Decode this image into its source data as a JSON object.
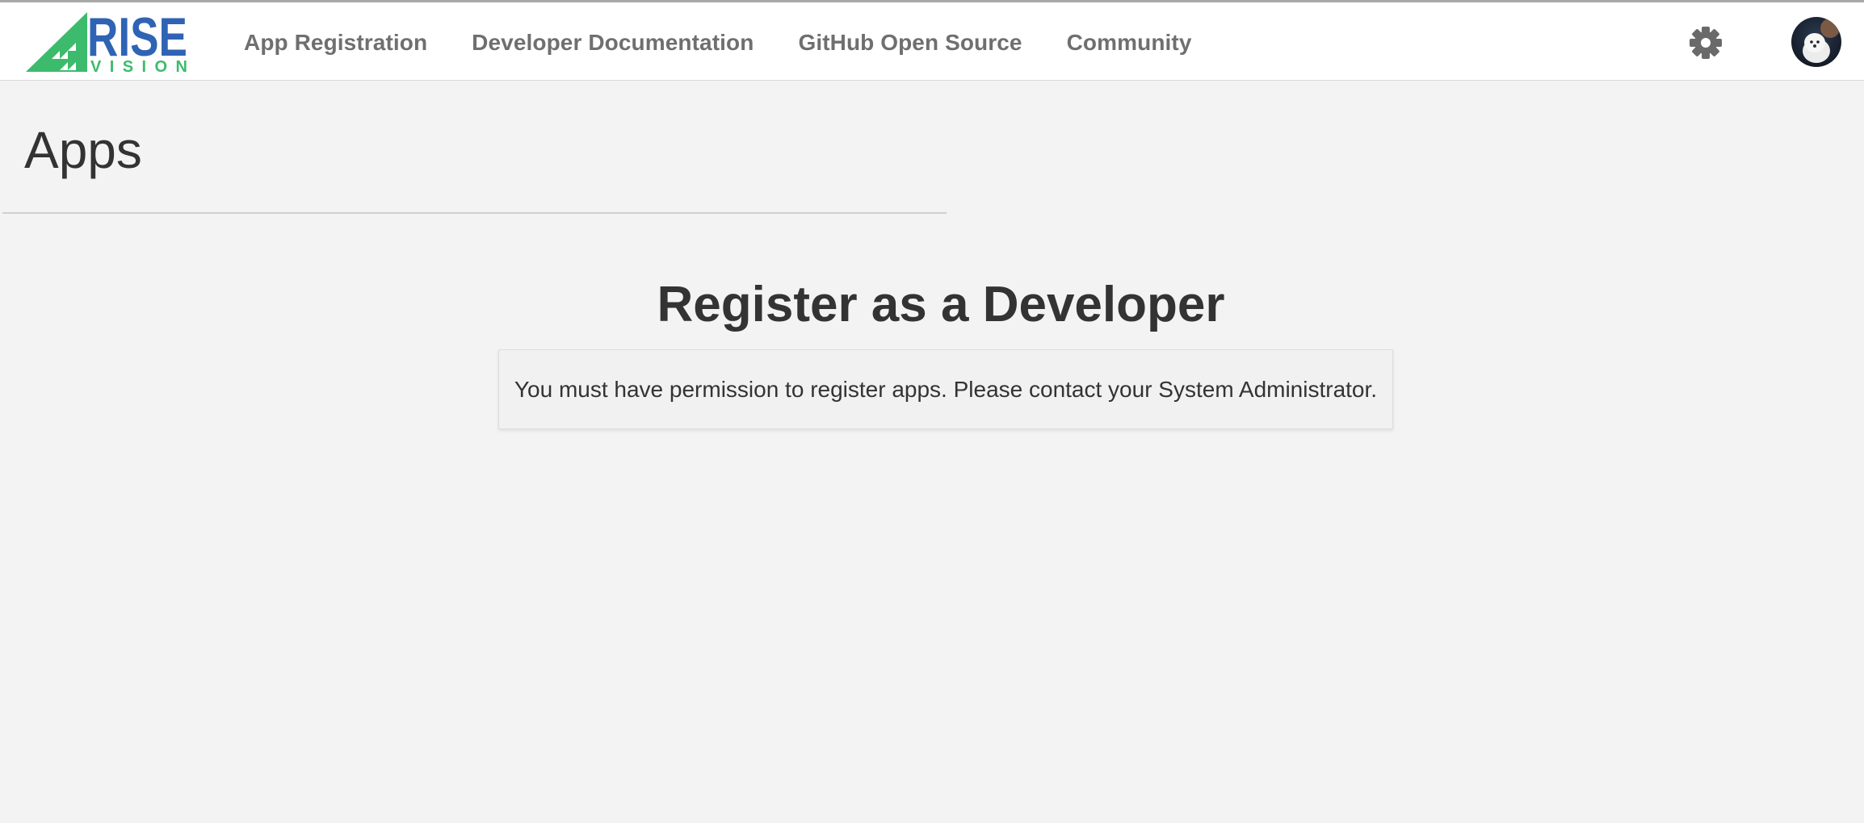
{
  "header": {
    "logo_text": "RISE",
    "logo_subtext": "VISION",
    "nav": [
      {
        "label": "App Registration"
      },
      {
        "label": "Developer Documentation"
      },
      {
        "label": "GitHub Open Source"
      },
      {
        "label": "Community"
      }
    ],
    "settings_icon": "gear-icon",
    "avatar_icon": "user-avatar"
  },
  "main": {
    "page_title": "Apps",
    "heading": "Register as a Developer",
    "notice": "You must have permission to register apps. Please contact your System Administrator."
  },
  "colors": {
    "logo_green": "#3dbb6d",
    "logo_blue": "#2f64b4",
    "nav_text": "#6f6f6f",
    "background": "#f3f3f3"
  }
}
